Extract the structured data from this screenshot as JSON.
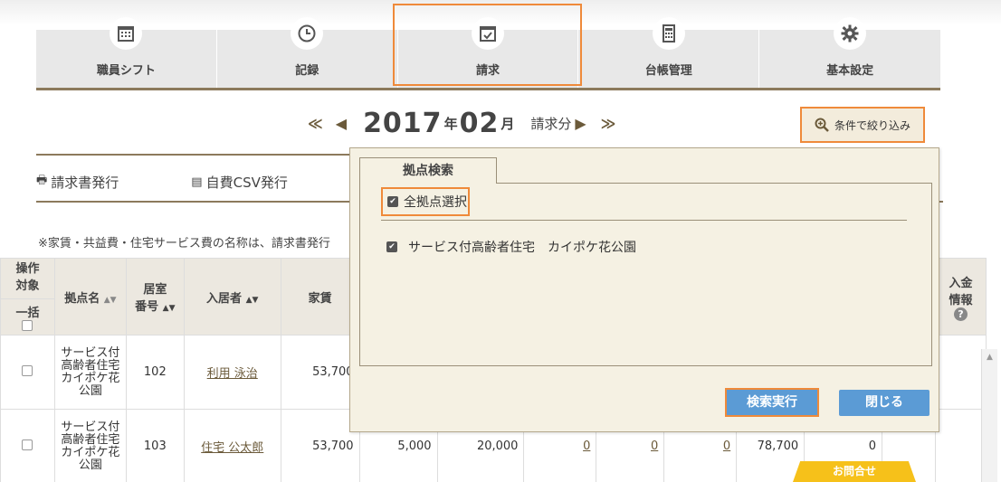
{
  "nav": {
    "items": [
      {
        "label": "職員シフト",
        "icon": "calendar-grid-icon"
      },
      {
        "label": "記録",
        "icon": "clock-icon"
      },
      {
        "label": "請求",
        "icon": "calendar-check-icon"
      },
      {
        "label": "台帳管理",
        "icon": "calculator-icon"
      },
      {
        "label": "基本設定",
        "icon": "gear-icon"
      }
    ],
    "active_index": 2
  },
  "period": {
    "first": "≪",
    "prev": "◀",
    "year": "2017",
    "year_unit": "年",
    "month": "02",
    "month_unit": "月",
    "suffix": "請求分",
    "next": "▶",
    "last": "≫"
  },
  "filter_button": {
    "label": "条件で絞り込み"
  },
  "actions": {
    "invoice": "請求書発行",
    "csv": "自費CSV発行"
  },
  "note": "※家賃・共益費・住宅サービス費の名称は、請求書発行",
  "table": {
    "headers": {
      "op_line1": "操作",
      "op_line2": "対象",
      "op_all": "一括",
      "site": "拠点名",
      "room_line1": "居室",
      "room_line2": "番号",
      "resident": "入居者",
      "rent": "家賃",
      "payment_line1": "入金",
      "payment_line2": "情報"
    },
    "rows": [
      {
        "site": "サービス付高齢者住宅　カイポケ花公園",
        "room": "102",
        "resident": "利用 泳治",
        "rent": "53,700",
        "c5": "",
        "c6": "",
        "c7": "",
        "c8": "",
        "c9": "",
        "c10": "",
        "c11": ""
      },
      {
        "site": "サービス付高齢者住宅　カイポケ花公園",
        "room": "103",
        "resident": "住宅 公太郎",
        "rent": "53,700",
        "c5": "5,000",
        "c6": "20,000",
        "c7": "0",
        "c8": "0",
        "c9": "0",
        "c10": "78,700",
        "c11": "0"
      }
    ]
  },
  "popup": {
    "tab": "拠点検索",
    "select_all": "全拠点選択",
    "facility": "サービス付高齢者住宅　カイポケ花公園",
    "search_button": "検索実行",
    "close_button": "閉じる"
  },
  "inquiry": "お問合せ"
}
